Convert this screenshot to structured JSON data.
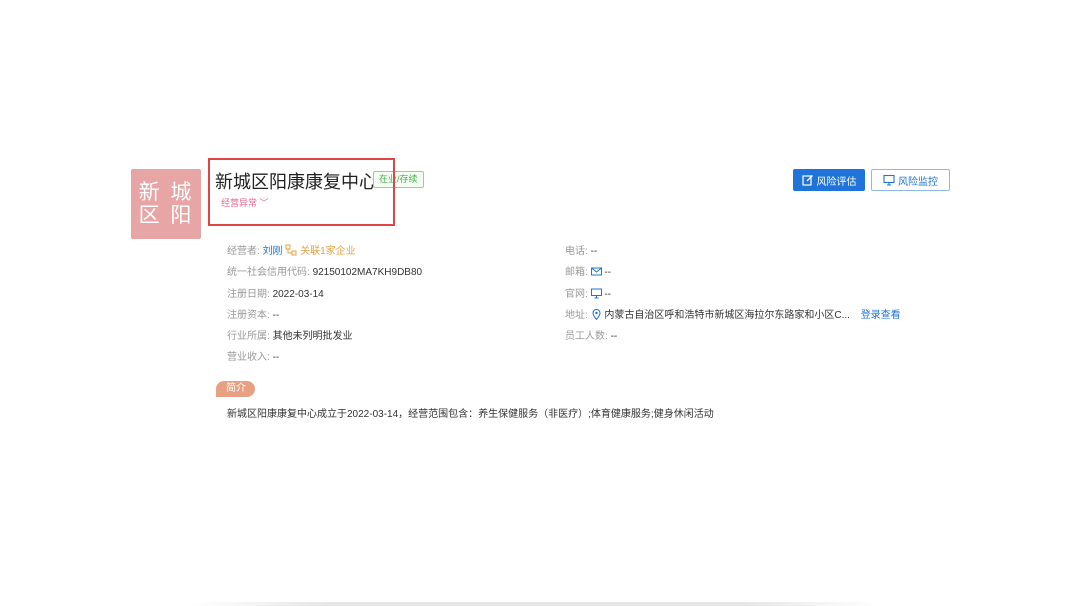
{
  "company": {
    "logo_line1": "新 城",
    "logo_line2": "区 阳",
    "name": "新城区阳康康复中心",
    "status": "在业/存续",
    "abnormal": "经营异常 ﹀"
  },
  "actions": {
    "risk_assess": "风险评估",
    "risk_monitor": "风险监控"
  },
  "left_fields": {
    "operator_label": "经营者:",
    "operator_value": "刘刚",
    "related_label": "关联1家企业",
    "credit_label": "统一社会信用代码:",
    "credit_value": "92150102MA7KH9DB80",
    "reg_date_label": "注册日期:",
    "reg_date_value": "2022-03-14",
    "capital_label": "注册资本:",
    "capital_value": "--",
    "industry_label": "行业所属:",
    "industry_value": "其他未列明批发业",
    "revenue_label": "营业收入:",
    "revenue_value": "--"
  },
  "right_fields": {
    "phone_label": "电话:",
    "phone_value": "--",
    "email_label": "邮箱:",
    "email_value": "--",
    "website_label": "官网:",
    "website_value": "--",
    "address_label": "地址:",
    "address_value": "内蒙古自治区呼和浩特市新城区海拉尔东路家和小区C...",
    "address_link": "登录查看",
    "staff_label": "员工人数:",
    "staff_value": "--"
  },
  "intro": {
    "tag": "简介",
    "text": "新城区阳康康复中心成立于2022-03-14，经营范围包含：养生保健服务（非医疗）;体育健康服务;健身休闲活动"
  },
  "colors": {
    "primary": "#1f73d9",
    "logo_bg": "#e8a5a5",
    "highlight": "#e04545",
    "status_green": "#4caf50"
  }
}
